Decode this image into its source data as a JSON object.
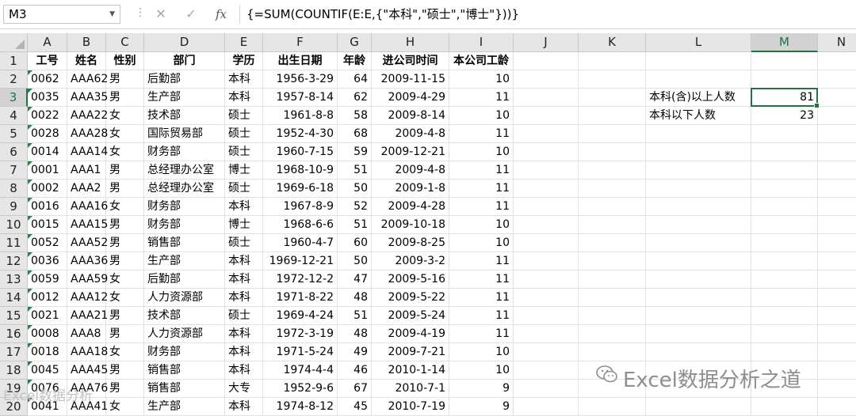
{
  "formula_bar": {
    "name_box": "M3",
    "formula": "{=SUM(COUNTIF(E:E,{\"本科\",\"硕士\",\"博士\"}))}",
    "fx_label": "fx",
    "cancel_icon": "cancel-icon",
    "enter_icon": "checkmark-icon"
  },
  "columns": [
    "A",
    "B",
    "C",
    "D",
    "E",
    "F",
    "G",
    "H",
    "I",
    "J",
    "K",
    "L",
    "M",
    "N"
  ],
  "rows": [
    "1",
    "2",
    "3",
    "4",
    "5",
    "6",
    "7",
    "8",
    "9",
    "10",
    "11",
    "12",
    "13",
    "14",
    "15",
    "16",
    "17",
    "18",
    "19",
    "20"
  ],
  "header": [
    "工号",
    "姓名",
    "性别",
    "部门",
    "学历",
    "出生日期",
    "年龄",
    "进公司时间",
    "本公司工龄"
  ],
  "data": [
    [
      "0062",
      "AAA62",
      "男",
      "后勤部",
      "本科",
      "1956-3-29",
      "64",
      "2009-11-15",
      "10"
    ],
    [
      "0035",
      "AAA35",
      "男",
      "生产部",
      "本科",
      "1957-8-14",
      "62",
      "2009-4-29",
      "11"
    ],
    [
      "0022",
      "AAA22",
      "女",
      "技术部",
      "硕士",
      "1961-8-8",
      "58",
      "2009-8-14",
      "10"
    ],
    [
      "0028",
      "AAA28",
      "女",
      "国际贸易部",
      "硕士",
      "1952-4-30",
      "68",
      "2009-4-8",
      "11"
    ],
    [
      "0014",
      "AAA14",
      "女",
      "财务部",
      "硕士",
      "1960-7-15",
      "59",
      "2009-12-21",
      "10"
    ],
    [
      "0001",
      "AAA1",
      "男",
      "总经理办公室",
      "博士",
      "1968-10-9",
      "51",
      "2009-4-8",
      "11"
    ],
    [
      "0002",
      "AAA2",
      "男",
      "总经理办公室",
      "硕士",
      "1969-6-18",
      "50",
      "2009-1-8",
      "11"
    ],
    [
      "0016",
      "AAA16",
      "女",
      "财务部",
      "本科",
      "1967-8-9",
      "52",
      "2009-4-28",
      "11"
    ],
    [
      "0015",
      "AAA15",
      "男",
      "财务部",
      "博士",
      "1968-6-6",
      "51",
      "2009-10-18",
      "10"
    ],
    [
      "0052",
      "AAA52",
      "男",
      "销售部",
      "硕士",
      "1960-4-7",
      "60",
      "2009-8-25",
      "10"
    ],
    [
      "0036",
      "AAA36",
      "男",
      "生产部",
      "本科",
      "1969-12-21",
      "50",
      "2009-3-2",
      "11"
    ],
    [
      "0059",
      "AAA59",
      "女",
      "后勤部",
      "本科",
      "1972-12-2",
      "47",
      "2009-5-16",
      "11"
    ],
    [
      "0012",
      "AAA12",
      "女",
      "人力资源部",
      "本科",
      "1971-8-22",
      "48",
      "2009-5-22",
      "11"
    ],
    [
      "0021",
      "AAA21",
      "男",
      "技术部",
      "硕士",
      "1969-4-24",
      "51",
      "2009-5-24",
      "11"
    ],
    [
      "0008",
      "AAA8",
      "男",
      "人力资源部",
      "本科",
      "1972-3-19",
      "48",
      "2009-4-19",
      "11"
    ],
    [
      "0018",
      "AAA18",
      "女",
      "财务部",
      "本科",
      "1971-5-24",
      "49",
      "2009-7-21",
      "10"
    ],
    [
      "0045",
      "AAA45",
      "男",
      "销售部",
      "本科",
      "1974-4-4",
      "46",
      "2010-1-14",
      "10"
    ],
    [
      "0076",
      "AAA76",
      "男",
      "销售部",
      "大专",
      "1952-9-6",
      "67",
      "2010-7-1",
      "9"
    ],
    [
      "0041",
      "AAA41",
      "女",
      "生产部",
      "本科",
      "1974-8-12",
      "45",
      "2010-7-19",
      "9"
    ]
  ],
  "summary": {
    "label_1": "本科(含)以上人数",
    "value_1": "81",
    "label_2": "本科以下人数",
    "value_2": "23"
  },
  "watermark": "Excel数据分析之道",
  "watermark_icon": "wechat-icon",
  "watermark_2": "Excel数据分析"
}
